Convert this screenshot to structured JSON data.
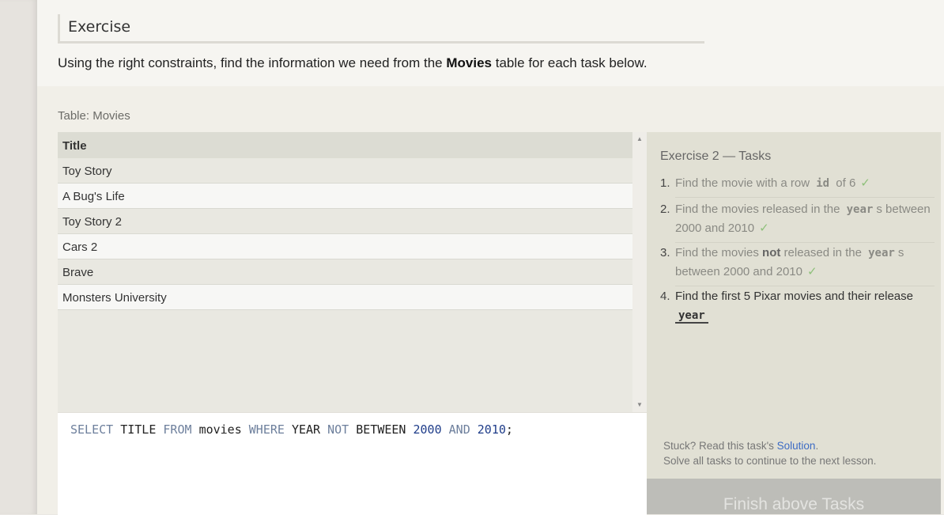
{
  "exercise": {
    "heading": "Exercise",
    "intro_prefix": "Using the right constraints, find the information we need from the ",
    "intro_bold": "Movies",
    "intro_suffix": " table for each task below."
  },
  "table": {
    "label": "Table: Movies",
    "columns": [
      "Title"
    ],
    "rows": [
      "Toy Story",
      "A Bug's Life",
      "Toy Story 2",
      "Cars 2",
      "Brave",
      "Monsters University"
    ]
  },
  "editor": {
    "query_tokens": [
      {
        "t": "SELECT",
        "k": "kw"
      },
      {
        "t": " ",
        "k": "punct"
      },
      {
        "t": "TITLE",
        "k": "id"
      },
      {
        "t": " ",
        "k": "punct"
      },
      {
        "t": "FROM",
        "k": "kw"
      },
      {
        "t": " ",
        "k": "punct"
      },
      {
        "t": "movies",
        "k": "id"
      },
      {
        "t": " ",
        "k": "punct"
      },
      {
        "t": "WHERE",
        "k": "kw"
      },
      {
        "t": " ",
        "k": "punct"
      },
      {
        "t": "YEAR",
        "k": "id"
      },
      {
        "t": " ",
        "k": "punct"
      },
      {
        "t": "NOT",
        "k": "kw"
      },
      {
        "t": " ",
        "k": "punct"
      },
      {
        "t": "BETWEEN",
        "k": "id"
      },
      {
        "t": " ",
        "k": "punct"
      },
      {
        "t": "2000",
        "k": "num"
      },
      {
        "t": " ",
        "k": "punct"
      },
      {
        "t": "AND",
        "k": "kw"
      },
      {
        "t": " ",
        "k": "punct"
      },
      {
        "t": "2010",
        "k": "num"
      },
      {
        "t": ";",
        "k": "punct"
      }
    ]
  },
  "tasks": {
    "title": "Exercise 2 — Tasks",
    "items": [
      {
        "n": "1.",
        "before": "Find the movie with a row ",
        "code": "id",
        "after": " of 6",
        "done": true
      },
      {
        "n": "2.",
        "before": "Find the movies released in the ",
        "code": "year",
        "after": "s between 2000 and 2010",
        "done": true
      },
      {
        "n": "3.",
        "before": "Find the movies ",
        "bold": "not",
        "mid": " released in the ",
        "code": "year",
        "after": "s between 2000 and 2010",
        "done": true
      },
      {
        "n": "4.",
        "before": "Find the first 5 Pixar movies and their release ",
        "code": "year",
        "after": "",
        "done": false
      }
    ],
    "check_glyph": "✓",
    "stuck_prefix": "Stuck? Read this task's ",
    "solution_link": "Solution",
    "stuck_suffix": ".",
    "solve_note": "Solve all tasks to continue to the next lesson."
  },
  "finish_button": "Finish above Tasks",
  "colors": {
    "link": "#3c6bc4",
    "check": "#8ec07a",
    "keyword": "#6d7f9c",
    "number": "#1f3d8a"
  }
}
